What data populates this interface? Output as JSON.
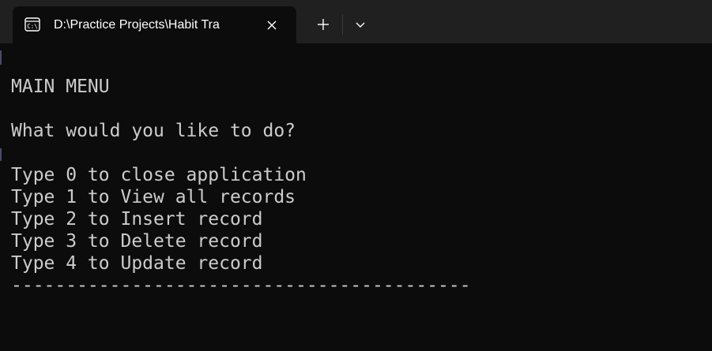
{
  "window": {
    "tab_title": "D:\\Practice Projects\\Habit Tra",
    "icons": {
      "tab_icon": "terminal-icon",
      "close": "close-icon",
      "new_tab": "plus-icon",
      "dropdown": "chevron-down-icon"
    }
  },
  "console": {
    "lines": [
      "",
      "MAIN MENU",
      "",
      "What would you like to do?",
      "",
      "Type 0 to close application",
      "Type 1 to View all records",
      "Type 2 to Insert record",
      "Type 3 to Delete record",
      "Type 4 to Update record",
      "------------------------------------------"
    ]
  },
  "colors": {
    "background": "#0c0c0c",
    "titlebar": "#202020",
    "text": "#cccccc"
  }
}
